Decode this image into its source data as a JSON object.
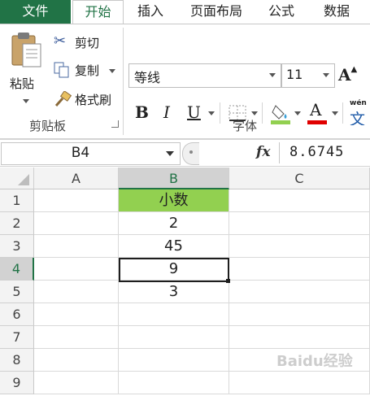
{
  "tabs": [
    "文件",
    "开始",
    "插入",
    "页面布局",
    "公式",
    "数据"
  ],
  "clipboard": {
    "paste": "粘贴",
    "cut": "剪切",
    "copy": "复制",
    "format_painter": "格式刷",
    "group_label": "剪贴板"
  },
  "font": {
    "name": "等线",
    "size": "11",
    "group_label": "字体",
    "bold": "B",
    "italic": "I",
    "underline": "U",
    "grow_font": "A",
    "font_color_letter": "A",
    "wen_label": "wén",
    "wen_char": "文"
  },
  "formula_bar": {
    "name_box": "B4",
    "fx": "fx",
    "value": "8.6745"
  },
  "sheet": {
    "columns": [
      "A",
      "B",
      "C"
    ],
    "rows": [
      "1",
      "2",
      "3",
      "4",
      "5",
      "6",
      "7",
      "8",
      "9"
    ],
    "b_values": [
      "小数",
      "2",
      "45",
      "9",
      "3",
      "",
      "",
      "",
      ""
    ],
    "header_fill": "#92d050",
    "selected_cell": "B4"
  },
  "watermark": "Baidu经验"
}
